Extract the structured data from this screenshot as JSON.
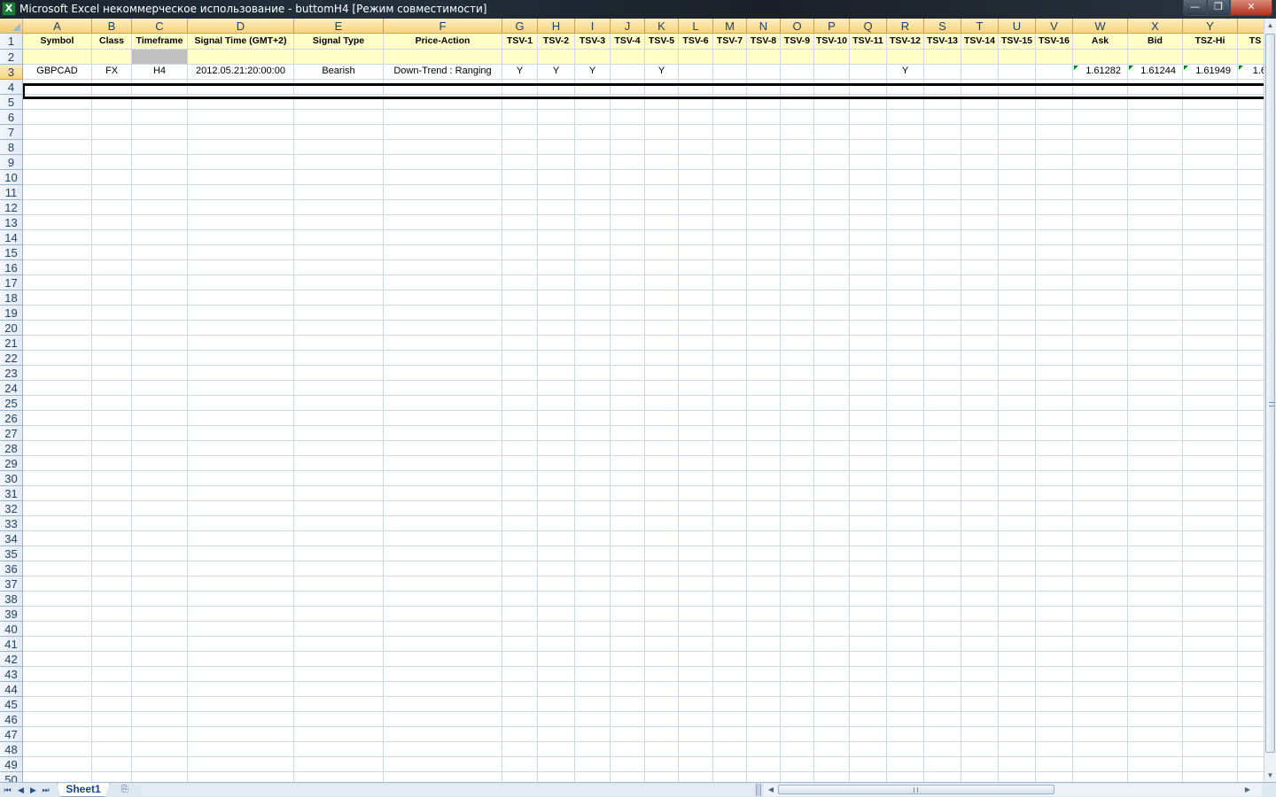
{
  "window": {
    "title": "Microsoft Excel некоммерческое использование - buttomH4  [Режим совместимости]",
    "minimize_glyph": "—",
    "maximize_glyph": "❐",
    "close_glyph": "✕",
    "app_icon_glyph": "X"
  },
  "columns": [
    "A",
    "B",
    "C",
    "D",
    "E",
    "F",
    "G",
    "H",
    "I",
    "J",
    "K",
    "L",
    "M",
    "N",
    "O",
    "P",
    "Q",
    "R",
    "S",
    "T",
    "U",
    "V",
    "W",
    "X",
    "Y",
    ""
  ],
  "row_numbers": [
    "1",
    "2",
    "3",
    "4",
    "5",
    "6",
    "7",
    "8",
    "9",
    "10",
    "11",
    "12",
    "13",
    "14",
    "15",
    "16",
    "17",
    "18",
    "19",
    "20",
    "21",
    "22",
    "23",
    "24",
    "25",
    "26",
    "27",
    "28",
    "29",
    "30",
    "31",
    "32",
    "33",
    "34",
    "35",
    "36",
    "37",
    "38",
    "39",
    "40",
    "41",
    "42",
    "43",
    "44",
    "45",
    "46",
    "47",
    "48",
    "49",
    "50"
  ],
  "selected_row": "3",
  "header_row": [
    "Symbol",
    "Class",
    "Timeframe",
    "Signal Time (GMT+2)",
    "Signal Type",
    "Price-Action",
    "TSV-1",
    "TSV-2",
    "TSV-3",
    "TSV-4",
    "TSV-5",
    "TSV-6",
    "TSV-7",
    "TSV-8",
    "TSV-9",
    "TSV-10",
    "TSV-11",
    "TSV-12",
    "TSV-13",
    "TSV-14",
    "TSV-15",
    "TSV-16",
    "Ask",
    "Bid",
    "TSZ-Hi",
    "TS"
  ],
  "data_row": [
    "GBPCAD",
    "FX",
    "H4",
    "2012.05.21:20:00:00",
    "Bearish",
    "Down-Trend : Ranging",
    "Y",
    "Y",
    "Y",
    "",
    "Y",
    "",
    "",
    "",
    "",
    "",
    "",
    "Y",
    "",
    "",
    "",
    "",
    "1.61282",
    "1.61244",
    "1.61949",
    "1.6"
  ],
  "sheets": {
    "active": "Sheet1",
    "nav_first": "⏮",
    "nav_prev": "◀",
    "nav_next": "▶",
    "nav_last": "⏭",
    "new_sheet_glyph": "⎘"
  },
  "scroll": {
    "up": "▲",
    "down": "▼",
    "left": "◀",
    "right": "▶"
  },
  "colors": {
    "header_fill": "#ffffc7",
    "grey_fill": "#c0c0c0",
    "gridline": "#d0d7e5",
    "sheet_tab_text": "#15428b"
  }
}
